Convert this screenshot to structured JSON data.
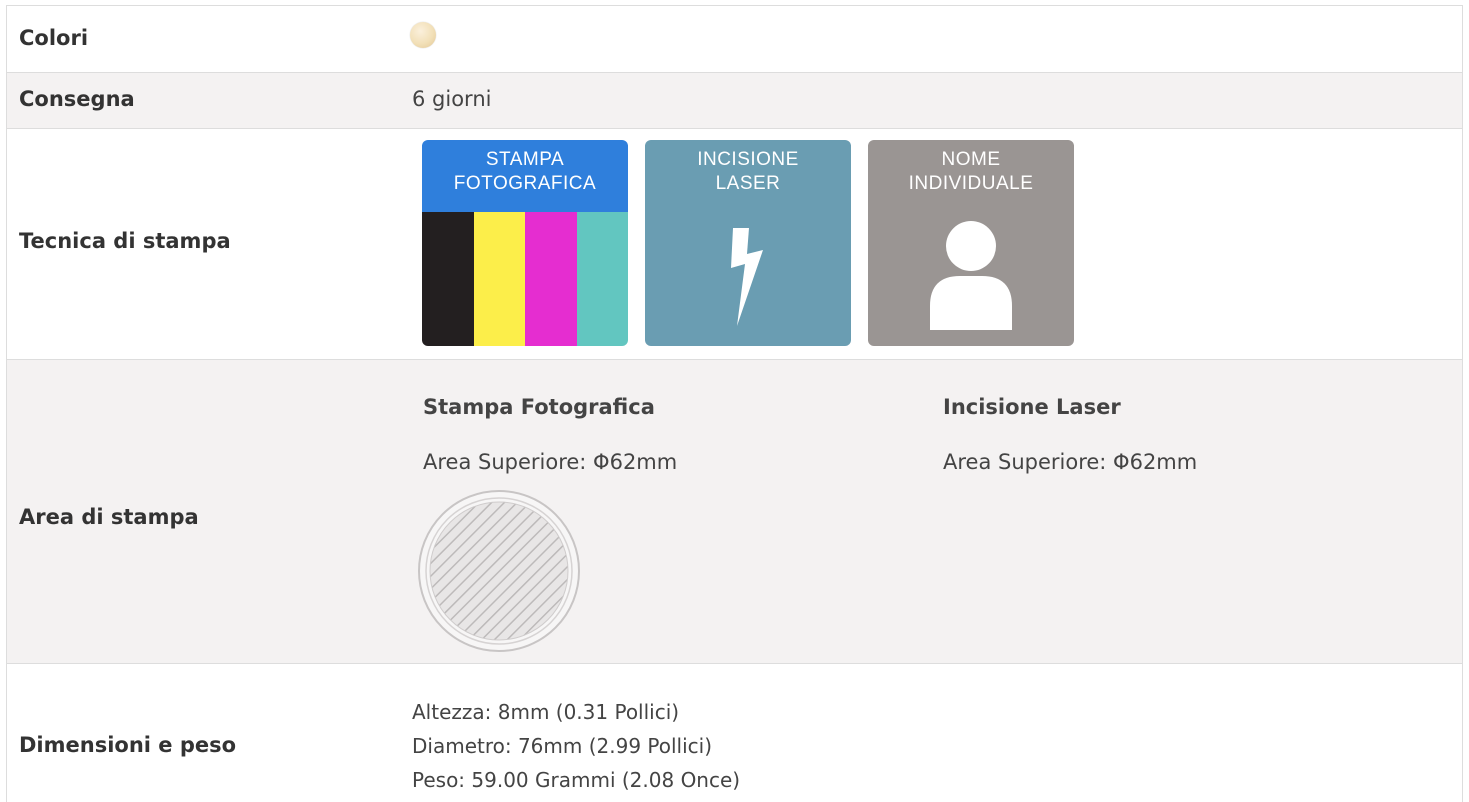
{
  "rows": {
    "colori": {
      "label": "Colori",
      "swatch_color": "#f2e0b8"
    },
    "consegna": {
      "label": "Consegna",
      "value": "6 giorni"
    },
    "tecnica": {
      "label": "Tecnica di stampa",
      "tiles": [
        {
          "title_line1": "STAMPA",
          "title_line2": "FOTOGRAFICA",
          "icon": "cmyk-bars-icon",
          "colors": [
            "#231f20",
            "#fcee4a",
            "#e52dd0",
            "#62c6c0"
          ]
        },
        {
          "title_line1": "INCISIONE",
          "title_line2": "LASER",
          "icon": "lightning-bolt-icon"
        },
        {
          "title_line1": "NOME",
          "title_line2": "INDIVIDUALE",
          "icon": "person-icon"
        }
      ]
    },
    "area": {
      "label": "Area di stampa",
      "photo": {
        "title": "Stampa Fotografica",
        "text": "Area Superiore: Φ62mm"
      },
      "laser": {
        "title": "Incisione Laser",
        "text": "Area Superiore: Φ62mm"
      }
    },
    "dimensioni": {
      "label": "Dimensioni e peso",
      "lines": [
        "Altezza: 8mm (0.31 Pollici)",
        "Diametro: 76mm (2.99 Pollici)",
        "Peso: 59.00 Grammi (2.08 Once)"
      ]
    }
  }
}
